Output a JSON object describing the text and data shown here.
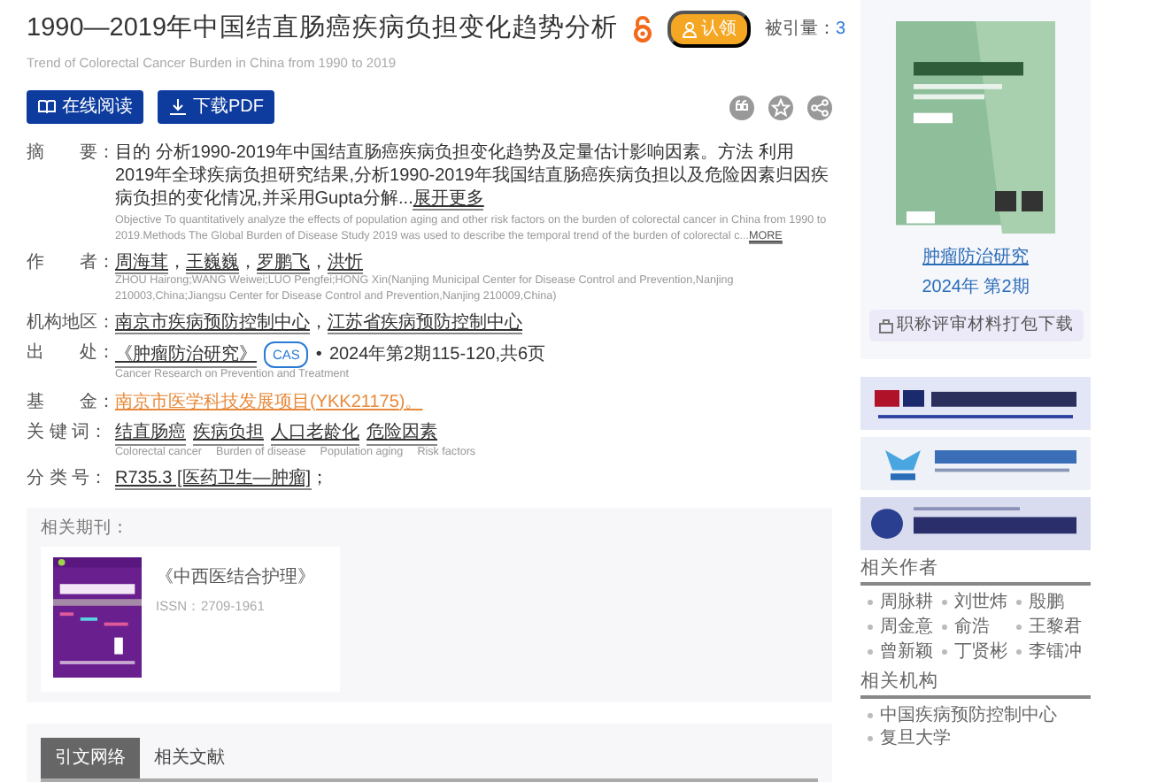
{
  "title": "1990—2019年中国结直肠癌疾病负担变化趋势分析",
  "open_access": true,
  "claim_badge": "认领",
  "citation": {
    "label": "被引量：",
    "count": "3"
  },
  "subtitle": "Trend of Colorectal Cancer Burden in China from 1990 to 2019",
  "buttons": [
    {
      "label": "在线阅读",
      "kind": "read"
    },
    {
      "label": "下载PDF",
      "kind": "download"
    }
  ],
  "actions": [
    {
      "kind": "quote"
    },
    {
      "kind": "star"
    },
    {
      "kind": "share"
    }
  ],
  "fields": [
    {
      "kind": "abstract",
      "label": "摘　　要：",
      "text": "目的 分析1990-2019年中国结直肠癌疾病负担变化趋势及定量估计影响因素。方法 利用2019年全球疾病负担研究结果,分析1990-2019年我国结直肠癌疾病负担以及危险因素归因疾病负担的变化情况,并采用Gupta分解...",
      "more": "展开更多",
      "english": "Objective To quantitatively analyze the effects of population aging and other risk factors on the burden of colorectal cancer in China from 1990 to 2019.Methods The Global Burden of Disease Study 2019 was used to describe the temporal trend of the burden of colorectal c...",
      "english_more": "MORE"
    },
    {
      "kind": "links",
      "label": "作　　者：",
      "items": [
        "周海茸",
        "王巍巍",
        "罗鹏飞",
        "洪忻"
      ],
      "separator": "，",
      "english": "ZHOU Hairong;WANG Weiwei;LUO Pengfei;HONG Xin(Nanjing Municipal Center for Disease Control and Prevention,Nanjing 210003,China;Jiangsu Center for Disease Control and Prevention,Nanjing 210009,China)"
    },
    {
      "kind": "links",
      "label": "机构地区：",
      "items": [
        "南京市疾病预防控制中心",
        "江苏省疾病预防控制中心"
      ],
      "separator": "，"
    },
    {
      "kind": "source",
      "label": "出　　处：",
      "journal": "《肿瘤防治研究》",
      "badge": "CAS",
      "bullet": "•",
      "detail": "2024年第2期115-120,共6页",
      "english": "Cancer Research on Prevention and Treatment"
    },
    {
      "kind": "fund",
      "label": "基　　金：",
      "text": "南京市医学科技发展项目(YKK21175)。"
    },
    {
      "kind": "keywords",
      "label": "关 键 词：",
      "items": [
        "结直肠癌",
        "疾病负担",
        "人口老龄化",
        "危险因素"
      ],
      "english": [
        "Colorectal cancer",
        "Burden of disease",
        "Population aging",
        "Risk factors"
      ]
    },
    {
      "kind": "classification",
      "label": "分 类 号：",
      "link": "R735.3 [医药卫生—肿瘤]",
      "suffix": "；"
    }
  ],
  "related_journal": {
    "label": "相关期刊：",
    "name": "《中西医结合护理》",
    "issn": "ISSN：2709-1961"
  },
  "tabs": [
    {
      "label": "引文网络",
      "selected": true
    },
    {
      "label": "相关文献",
      "selected": false
    }
  ],
  "sidebar": {
    "journal": "肿瘤防治研究",
    "issue": "2024年 第2期",
    "download_button": "职称评审材料打包下载",
    "related_authors": {
      "heading": "相关作者",
      "items": [
        "周脉耕",
        "刘世炜",
        "殷鹏",
        "周金意",
        "俞浩",
        "王黎君",
        "曾新颖",
        "丁贤彬",
        "李镭冲"
      ]
    },
    "related_institutions": {
      "heading": "相关机构",
      "items": [
        "中国疾病预防控制中心",
        "复旦大学"
      ]
    }
  }
}
